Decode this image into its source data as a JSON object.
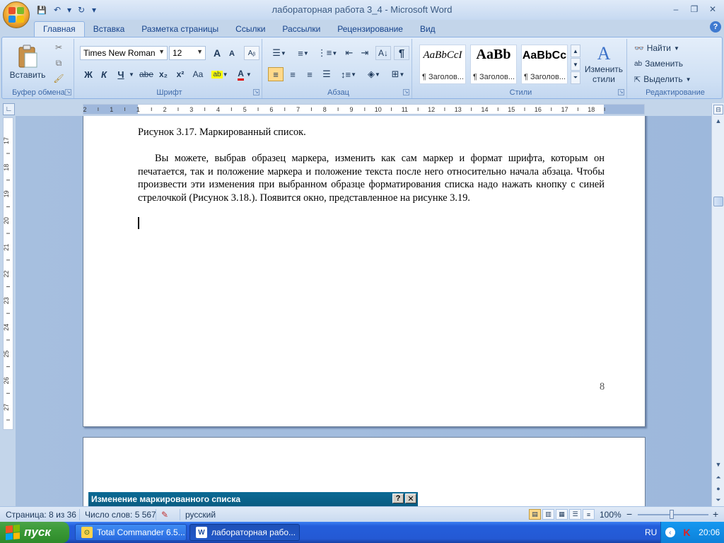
{
  "window": {
    "title": "лабораторная работа 3_4 - Microsoft Word",
    "minimize": "–",
    "restore": "❐",
    "close": "✕"
  },
  "qat": {
    "save": "💾",
    "undo": "↶",
    "undo_dropdown": "▾",
    "redo": "↻",
    "customize": "▾"
  },
  "tabs": [
    {
      "label": "Главная",
      "active": true
    },
    {
      "label": "Вставка"
    },
    {
      "label": "Разметка страницы"
    },
    {
      "label": "Ссылки"
    },
    {
      "label": "Рассылки"
    },
    {
      "label": "Рецензирование"
    },
    {
      "label": "Вид"
    }
  ],
  "help_label": "?",
  "ribbon": {
    "clipboard": {
      "label": "Буфер обмена",
      "paste": "Вставить"
    },
    "font": {
      "label": "Шрифт",
      "font_name": "Times New Roman",
      "font_size": "12",
      "bold": "Ж",
      "italic": "К",
      "underline": "Ч",
      "strike": "abe",
      "subscript": "x₂",
      "superscript": "x²",
      "case": "Aa",
      "grow": "A",
      "shrink": "A"
    },
    "paragraph": {
      "label": "Абзац",
      "show_marks": "¶"
    },
    "styles": {
      "label": "Стили",
      "tiles": [
        {
          "sample": "AaBbCcI",
          "name": "¶ Заголов..."
        },
        {
          "sample": "AaBb",
          "name": "¶ Заголов..."
        },
        {
          "sample": "AaBbCc",
          "name": "¶ Заголов..."
        }
      ],
      "change_styles_line1": "Изменить",
      "change_styles_line2": "стили"
    },
    "editing": {
      "label": "Редактирование",
      "find": "Найти",
      "replace": "Заменить",
      "select": "Выделить"
    }
  },
  "ruler": {
    "h_ticks": [
      "2",
      "1",
      "1",
      "2",
      "3",
      "4",
      "5",
      "6",
      "7",
      "8",
      "9",
      "10",
      "11",
      "12",
      "13",
      "14",
      "15",
      "16",
      "17",
      "18"
    ],
    "v_ticks": [
      "17",
      "18",
      "19",
      "20",
      "21",
      "22",
      "23",
      "24",
      "25",
      "26",
      "27"
    ]
  },
  "document": {
    "caption": "Рисунок 3.17. Маркированный список.",
    "paragraph": "Вы можете, выбрав образец маркера, изменить как сам маркер и формат шрифта, которым он печатается, так и положение маркера и положение текста после него относительно начала абзаца. Чтобы произвести эти изменения при выбранном образце форматирования списка надо нажать кнопку с синей стрелочкой (Рисунок 3.18.). Появится окно, представленное на рисунке 3.19.",
    "page_number": "8",
    "dialog_title": "Изменение маркированного списка",
    "dialog_help": "?",
    "dialog_close": "✕"
  },
  "status": {
    "page": "Страница: 8 из 36",
    "words": "Число слов: 5 567",
    "language": "русский",
    "zoom": "100%",
    "zoom_minus": "−",
    "zoom_plus": "+"
  },
  "taskbar": {
    "start": "пуск",
    "items": [
      {
        "label": "Total Commander 6.5...",
        "active": false
      },
      {
        "label": "лабораторная рабо...",
        "active": true
      }
    ],
    "lang": "RU",
    "clock": "20:06"
  },
  "colors": {
    "accent": "#15428b",
    "start_green": "#3b9a37",
    "taskbar_blue": "#245edb",
    "dialog_title": "#0b6a94"
  }
}
